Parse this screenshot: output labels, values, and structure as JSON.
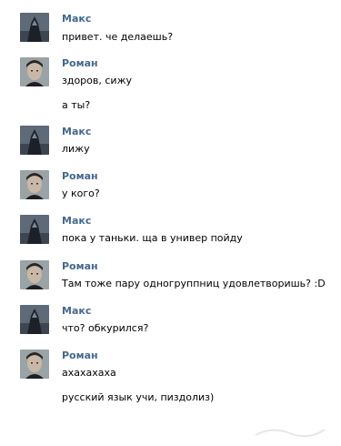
{
  "messages": [
    {
      "sender": "Макс",
      "avatar": "maks-avatar",
      "lines": [
        "привет. че делаешь?"
      ]
    },
    {
      "sender": "Роман",
      "avatar": "roman-avatar",
      "lines": [
        "здоров, сижу",
        "а ты?"
      ]
    },
    {
      "sender": "Макс",
      "avatar": "maks-avatar",
      "lines": [
        "лижу"
      ]
    },
    {
      "sender": "Роман",
      "avatar": "roman-avatar",
      "lines": [
        "у кого?"
      ]
    },
    {
      "sender": "Макс",
      "avatar": "maks-avatar",
      "lines": [
        "пока у таньки. ща в универ пойду"
      ]
    },
    {
      "sender": "Роман",
      "avatar": "roman-avatar",
      "lines": [
        "Там тоже пару одногруппниц удовлетворишь? :D"
      ]
    },
    {
      "sender": "Макс",
      "avatar": "maks-avatar",
      "lines": [
        "что? обкурился?"
      ]
    },
    {
      "sender": "Роман",
      "avatar": "roman-avatar",
      "lines": [
        "ахахахаха",
        "русский язык учи, пиздолиз)"
      ]
    }
  ]
}
